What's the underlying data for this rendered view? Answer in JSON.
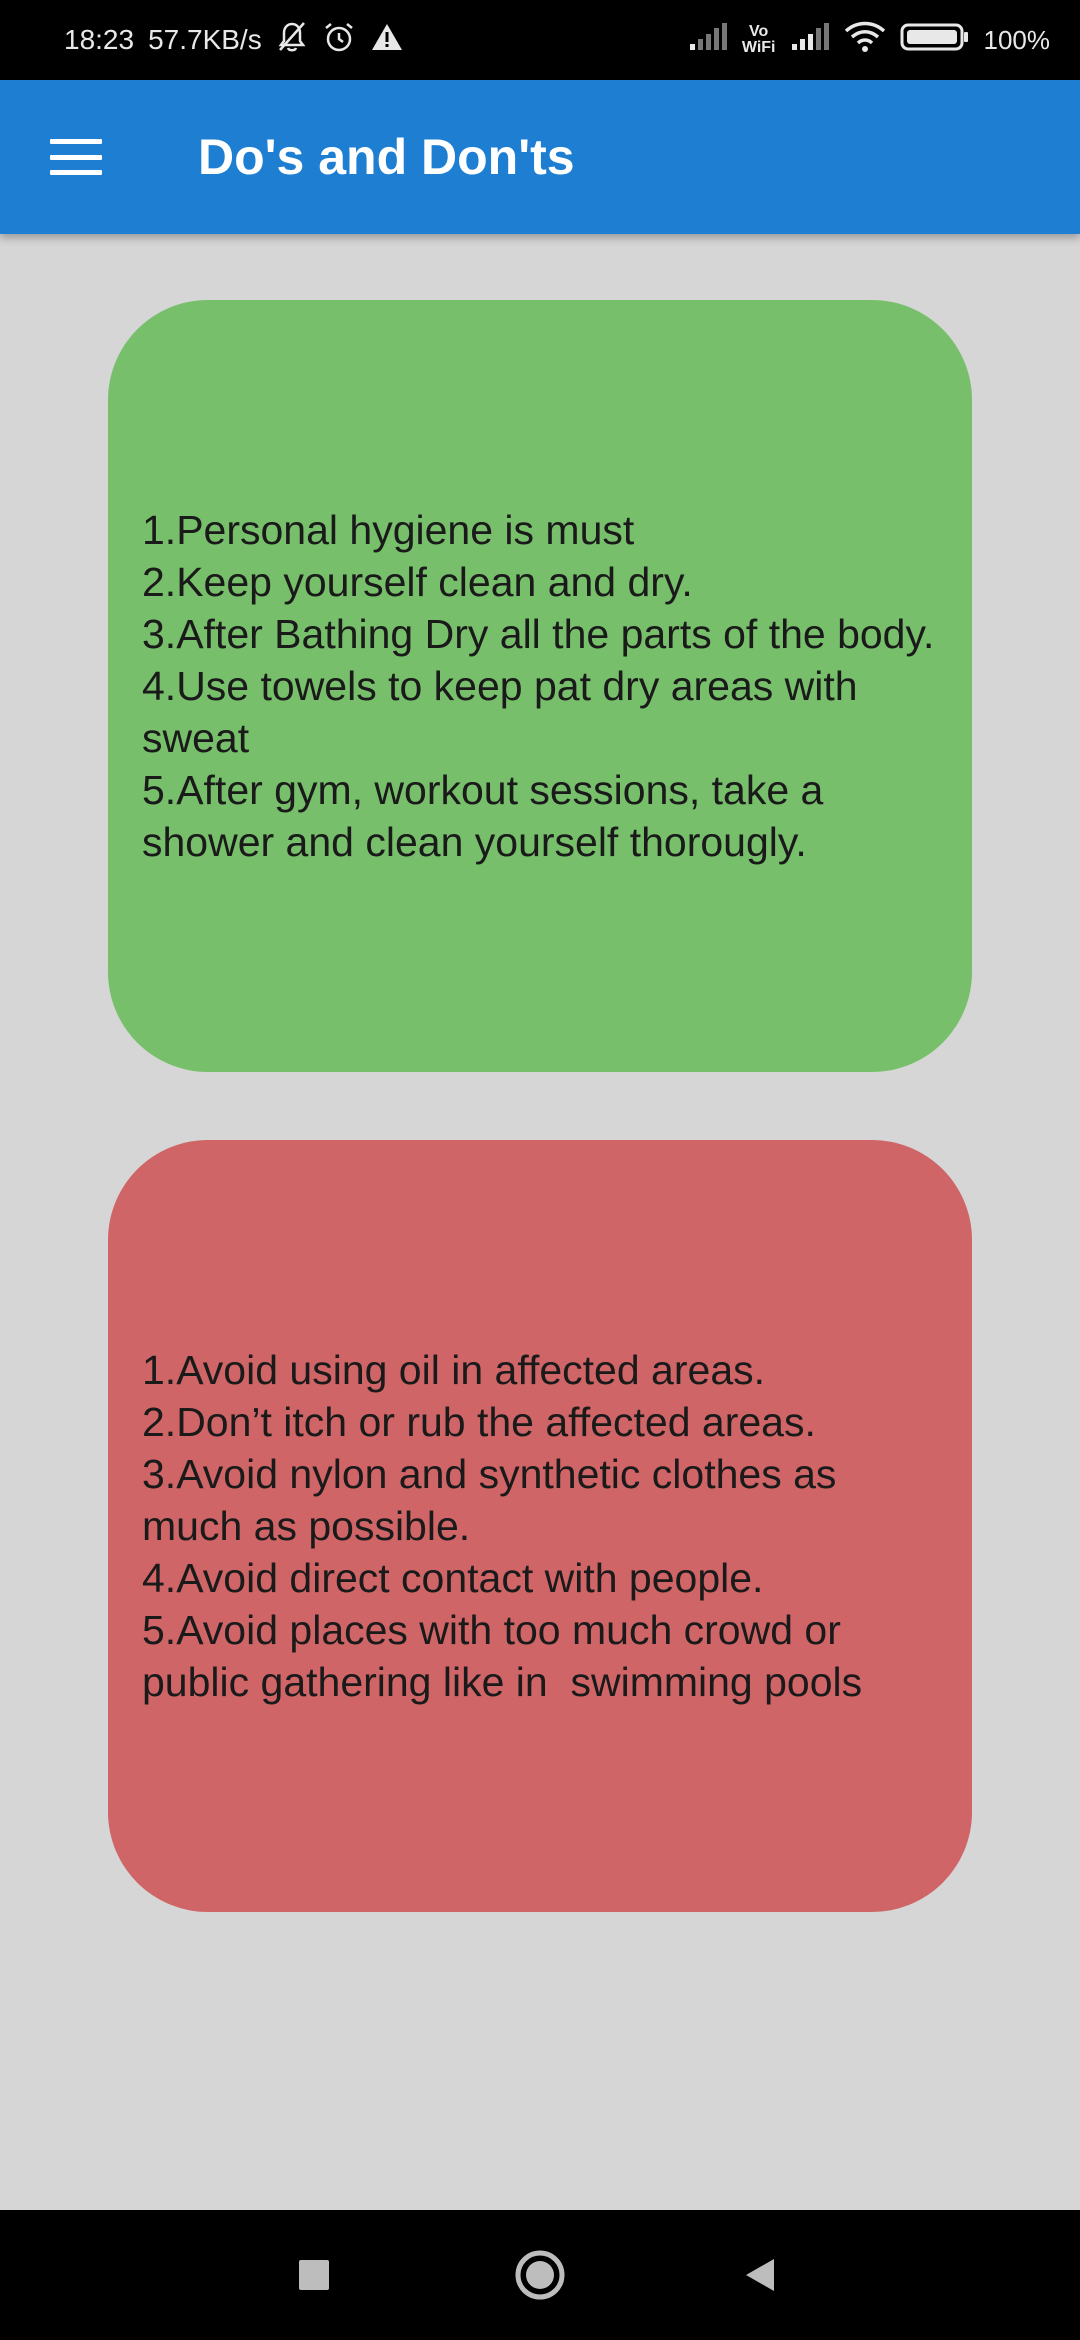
{
  "status_bar": {
    "time": "18:23",
    "network_speed": "57.7KB/s",
    "vowifi_line1": "Vo",
    "vowifi_line2": "WiFi",
    "battery": "100%",
    "icons": [
      "bell-off-icon",
      "alarm-icon",
      "warning-icon",
      "signal-icon",
      "wifi-icon",
      "battery-icon"
    ]
  },
  "app_bar": {
    "title": "Do's and Don'ts",
    "background": "#1e7fd2",
    "menu_icon": "hamburger-menu-icon"
  },
  "cards": {
    "dos": {
      "color": "#77bf6b",
      "text": "1.Personal hygiene is must\n2.Keep yourself clean and dry.\n3.After Bathing Dry all the parts of the body.\n4.Use towels to keep pat dry areas with sweat\n5.After gym, workout sessions, take a shower and clean yourself thorougly."
    },
    "donts": {
      "color": "#cf6567",
      "text": "1.Avoid using oil in affected areas.\n2.Don’t itch or rub the affected areas.\n3.Avoid nylon and synthetic clothes as much as possible.\n4.Avoid direct contact with people.\n5.Avoid places with too much crowd or public gathering like in  swimming pools"
    }
  },
  "nav_bar": {
    "buttons": [
      "recents-icon",
      "home-icon",
      "back-icon"
    ]
  }
}
